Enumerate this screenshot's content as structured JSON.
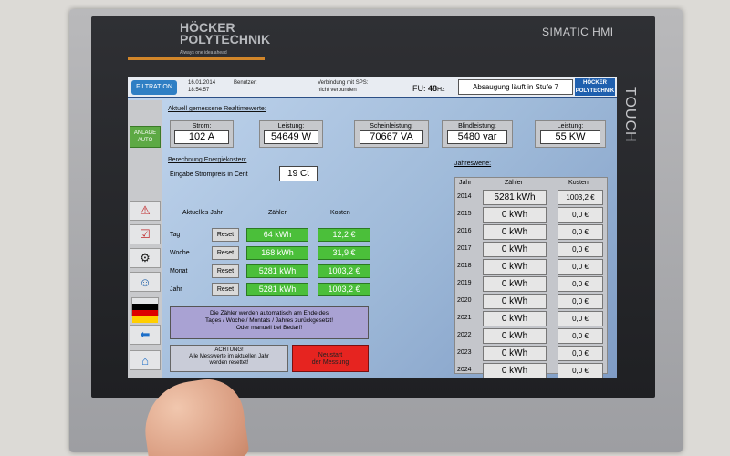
{
  "device": {
    "brand_line1": "HÖCKER",
    "brand_line2": "POLYTECHNIK",
    "brand_tagline": "Always one idea ahead",
    "model": "SIMATIC HMI",
    "touch_label": "TOUCH"
  },
  "header": {
    "logo_text": "FILTRATION",
    "date": "16.01.2014",
    "time": "18:54:57",
    "user_label": "Benutzer:",
    "sps_label": "Verbindung mit SPS:",
    "sps_value": "nicht verbunden",
    "fu_label": "FU:",
    "fu_value": "48",
    "fu_unit": "Hz",
    "status": "Absaugung läuft in Stufe 7",
    "corner_logo_1": "HÖCKER",
    "corner_logo_2": "POLYTECHNIK"
  },
  "nav": {
    "mode_line1": "ANLAGE",
    "mode_line2": "AUTO",
    "icons": [
      "warning-icon",
      "checklist-icon",
      "gear-icon",
      "user-icon",
      "flag-de-icon",
      "back-arrow-icon",
      "home-icon"
    ]
  },
  "realtime": {
    "title": "Aktuell gemessene Realtimewerte:",
    "items": [
      {
        "label": "Strom:",
        "value": "102 A"
      },
      {
        "label": "Leistung:",
        "value": "54649 W"
      },
      {
        "label": "Scheinleistung:",
        "value": "70667 VA"
      },
      {
        "label": "Blindleistung:",
        "value": "5480 var"
      },
      {
        "label": "Leistung:",
        "value": "55 KW"
      }
    ]
  },
  "energy": {
    "title": "Berechnung Energiekosten:",
    "price_label": "Eingabe Strompreis in Cent",
    "price_value": "19 Ct",
    "headers": {
      "period": "Aktuelles Jahr",
      "counter": "Zähler",
      "cost": "Kosten"
    },
    "reset_label": "Reset",
    "rows": [
      {
        "label": "Tag",
        "counter": "64 kWh",
        "cost": "12,2 €"
      },
      {
        "label": "Woche",
        "counter": "168 kWh",
        "cost": "31,9 €"
      },
      {
        "label": "Monat",
        "counter": "5281 kWh",
        "cost": "1003,2 €"
      },
      {
        "label": "Jahr",
        "counter": "5281 kWh",
        "cost": "1003,2 €"
      }
    ],
    "info_line1": "Die Zähler werden automatisch am Ende des",
    "info_line2": "Tages / Woche / Montats / Jahres zurückgesetzt!",
    "info_line3": "Oder manuell bei Bedarf!",
    "warn_line1": "ACHTUNG!",
    "warn_line2": "Alle Messwerte im aktuellen Jahr",
    "warn_line3": "werden resettet!",
    "restart_line1": "Neustart",
    "restart_line2": "der Messung"
  },
  "yearly": {
    "title": "Jahreswerte:",
    "headers": {
      "year": "Jahr",
      "counter": "Zähler",
      "cost": "Kosten"
    },
    "rows": [
      {
        "year": "2014",
        "counter": "5281 kWh",
        "cost": "1003,2 €"
      },
      {
        "year": "2015",
        "counter": "0 kWh",
        "cost": "0,0 €"
      },
      {
        "year": "2016",
        "counter": "0 kWh",
        "cost": "0,0 €"
      },
      {
        "year": "2017",
        "counter": "0 kWh",
        "cost": "0,0 €"
      },
      {
        "year": "2018",
        "counter": "0 kWh",
        "cost": "0,0 €"
      },
      {
        "year": "2019",
        "counter": "0 kWh",
        "cost": "0,0 €"
      },
      {
        "year": "2020",
        "counter": "0 kWh",
        "cost": "0,0 €"
      },
      {
        "year": "2021",
        "counter": "0 kWh",
        "cost": "0,0 €"
      },
      {
        "year": "2022",
        "counter": "0 kWh",
        "cost": "0,0 €"
      },
      {
        "year": "2023",
        "counter": "0 kWh",
        "cost": "0,0 €"
      },
      {
        "year": "2024",
        "counter": "0 kWh",
        "cost": "0,0 €"
      }
    ]
  },
  "colors": {
    "counter_green": "#4bbf3a",
    "restart_red": "#e62420",
    "accent_orange": "#d2862a",
    "header_blue": "#2b4f86"
  }
}
